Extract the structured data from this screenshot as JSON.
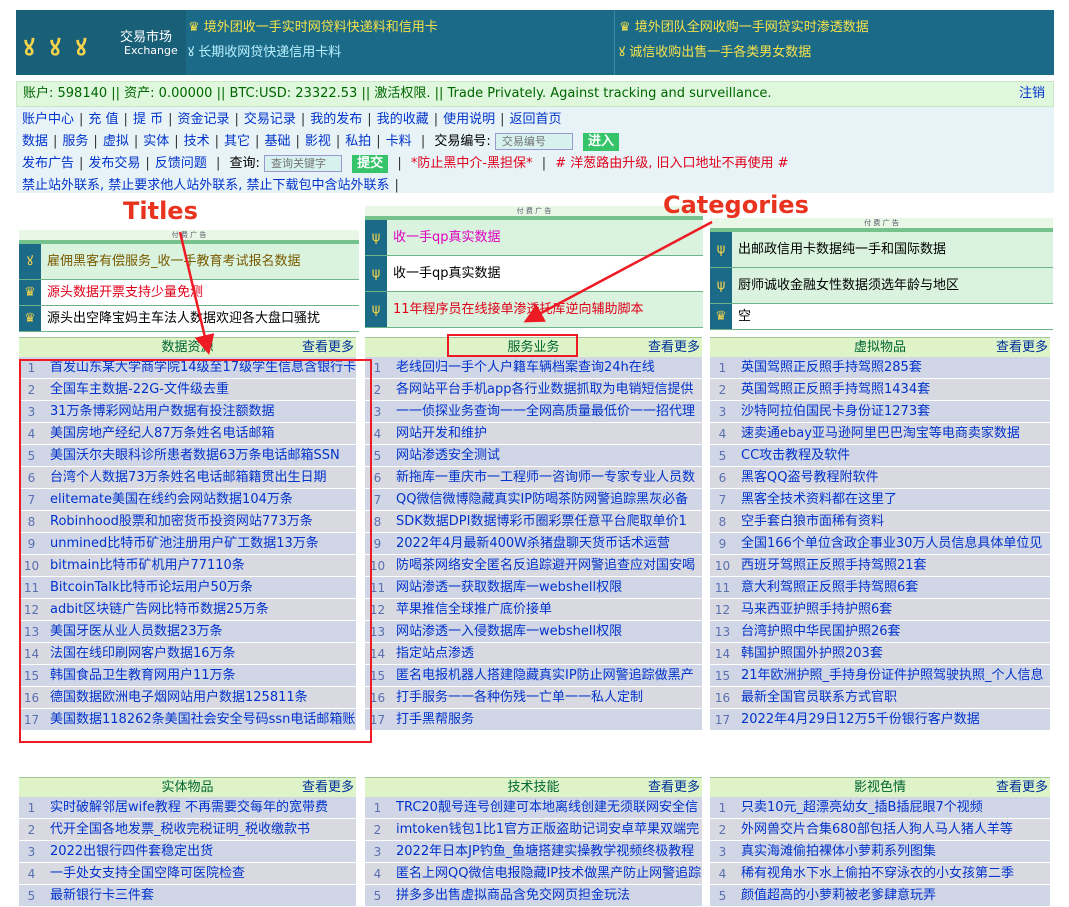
{
  "header": {
    "logo_glyphs": "ꙋ ꙋ ꙋ",
    "logo_title": "交易市场",
    "logo_subtitle": "Exchange",
    "cells": [
      "♛ 境外团收一手实时网贷料快递料和信用卡",
      "ꙋ 长期收网贷快递信用卡料",
      "♛ 境外团队全网收购一手网贷实时渗透数据",
      "ꙋ 诚信收购出售一手各类男女数据"
    ]
  },
  "account": {
    "text": "账户: 598140  ||  资产: 0.00000  ||  BTC:USD: 23322.53  ||  激活权限.  ||  Trade Privately. Against tracking and surveillance.",
    "logout": "注销"
  },
  "nav": {
    "row1": [
      "账户中心",
      "充 值",
      "提 币",
      "资金记录",
      "交易记录",
      "我的发布",
      "我的收藏",
      "使用说明",
      "返回首页"
    ],
    "row2": [
      "数据",
      "服务",
      "虚拟",
      "实体",
      "技术",
      "其它",
      "基础",
      "影视",
      "私拍",
      "卡料"
    ],
    "trade_label": "交易编号:",
    "trade_placeholder": "交易编号",
    "trade_button": "进入",
    "row3": [
      "发布广告",
      "发布交易",
      "反馈问题"
    ],
    "query_label": "查询:",
    "query_placeholder": "查询关键字",
    "query_button": "提交",
    "warn1": "*防止黑中介-黑担保*",
    "warn2": "# 洋葱路由升级, 旧入口地址不再使用 #",
    "row4": "禁止站外联系, 禁止要求他人站外联系, 禁止下载包中含站外联系"
  },
  "annotations": {
    "titles": "Titles",
    "categories": "Categories"
  },
  "ads": {
    "label": "付 费 广 告",
    "left": [
      "雇佣黑客有偿服务_收一手教育考试报名数据",
      "源头数据开票支持少量免测",
      "源头出空降宝妈主车法人数据欢迎各大盘口骚扰"
    ],
    "middle": [
      "收一手qp真实数据",
      "收一手qp真实数据",
      "11年程序员在线接单渗透托库逆向辅助脚本"
    ],
    "right": [
      "出邮政信用卡数据纯一手和国际数据",
      "厨师诚收金融女性数据须选年龄与地区",
      "空"
    ]
  },
  "more_label": "查看更多",
  "lists": [
    {
      "title": "数据资源",
      "items": [
        "首发山东某大学商学院14级至17级学生信息含银行卡",
        "全国车主数据-22G-文件级去重",
        "31万条博彩网站用户数据有投注额数据",
        "美国房地产经纪人87万条姓名电话邮箱",
        "美国沃尔夫眼科诊所患者数据63万条电话邮箱SSN",
        "台湾个人数据73万条姓名电话邮箱籍贯出生日期",
        "elitemate美国在线约会网站数据104万条",
        "Robinhood股票和加密货币投资网站773万条",
        "unmined比特币矿池注册用户矿工数据13万条",
        "bitmain比特币矿机用户77110条",
        "BitcoinTalk比特币论坛用户50万条",
        "adbit区块链广告网比特币数据25万条",
        "美国牙医从业人员数据23万条",
        "法国在线印刷网客户数据16万条",
        "韩国食品卫生教育网用户11万条",
        "德国数据欧洲电子烟网站用户数据125811条",
        "美国数据118262条美国社会安全号码ssn电话邮箱账"
      ]
    },
    {
      "title": "服务业务",
      "items": [
        "老线回归一手个人户籍车辆档案查询24h在线",
        "各网站平台手机app各行业数据抓取为电销短信提供",
        "一一侦探业务查询一一全网高质量最低价一一招代理",
        "网站开发和维护",
        "网站渗透安全测试",
        "新拖库一重庆市一工程师一咨询师一专家专业人员数",
        "QQ微信微博隐藏真实IP防喝茶防网警追踪黑灰必备",
        "SDK数据DPI数据博彩币圈彩票任意平台爬取单价1",
        "2022年4月最新400W杀猪盘聊天货币话术运营",
        "防喝茶网络安全匿名反追踪避开网警追查应对国安喝",
        "网站渗透一获取数据库一webshell权限",
        "苹果推信全球推广底价接单",
        "网站渗透一入侵数据库一webshell权限",
        "指定站点渗透",
        "匿名电报机器人搭建隐藏真实IP防止网警追踪做黑产",
        "打手服务一一各种伤残一亡单一一私人定制",
        "打手黑帮服务"
      ]
    },
    {
      "title": "虚拟物品",
      "items": [
        "英国驾照正反照手持驾照285套",
        "英国驾照正反照手持驾照1434套",
        "沙特阿拉伯国民卡身份证1273套",
        "速卖通ebay亚马逊阿里巴巴淘宝等电商卖家数据",
        "CC攻击教程及软件",
        "黑客QQ盗号教程附软件",
        "黑客全技术资料都在这里了",
        "空手套白狼市面稀有资料",
        "全国166个单位含政企事业30万人员信息具体单位见",
        "西班牙驾照正反照手持驾照21套",
        "意大利驾照正反照手持驾照6套",
        "马来西亚护照手持护照6套",
        "台湾护照中华民国护照26套",
        "韩国护照国外护照203套",
        "21年欧洲护照_手持身份证件护照驾驶执照_个人信息",
        "最新全国官员联系方式官职",
        "2022年4月29日12万5千份银行客户数据"
      ]
    },
    {
      "title": "实体物品",
      "items": [
        "实时破解邻居wife教程 不再需要交每年的宽带费",
        "代开全国各地发票_税收完税证明_税收缴款书",
        "2022出银行四件套稳定出货",
        "一手处女支持全国空降可医院检查",
        "最新银行卡三件套"
      ]
    },
    {
      "title": "技术技能",
      "items": [
        "TRC20靓号连号创建可本地离线创建无须联网安全信",
        "imtoken钱包1比1官方正版盗助记词安卓苹果双端完",
        "2022年日本JP钓鱼_鱼塘搭建实操教学视频终极教程",
        "匿名上网QQ微信电报隐藏IP技术做黑产防止网警追踪",
        "拼多多出售虚拟商品含免交网页担金玩法"
      ]
    },
    {
      "title": "影视色情",
      "items": [
        "只卖10元_超漂亮幼女_插B插屁眼7个视频",
        "外网兽交片合集680部包括人狗人马人猪人羊等",
        "真实海滩偷拍裸体小萝莉系列图集",
        "稀有视角水下水上偷拍不穿泳衣的小女孩第二季",
        "颜值超高的小萝莉被老爹肆意玩弄"
      ]
    }
  ]
}
